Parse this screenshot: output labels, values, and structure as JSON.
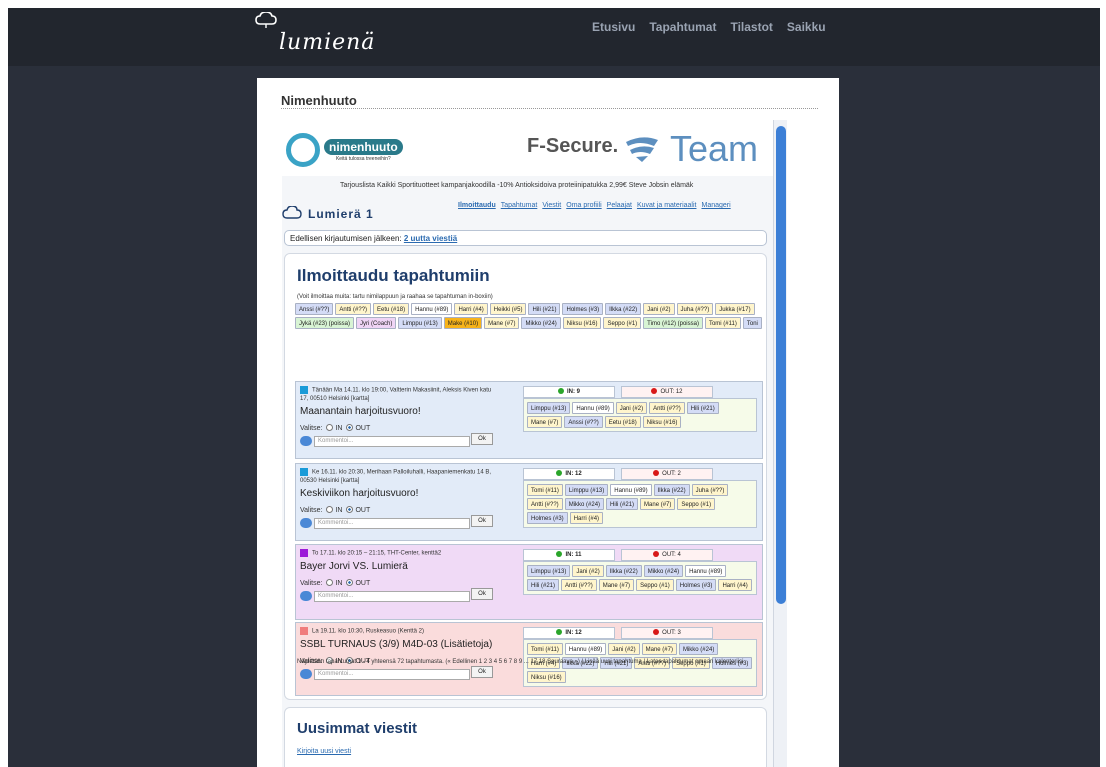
{
  "site": {
    "logo": "lumienä"
  },
  "topnav": [
    "Etusivu",
    "Tapahtumat",
    "Tilastot",
    "Saikku"
  ],
  "content": {
    "title": "Nimenhuuto"
  },
  "banner": {
    "nh_name": "nimenhuuto",
    "nh_tag": "Keitä tulossa treeneihin?",
    "fsecure": "F-Secure.",
    "team": "Team",
    "ticker": "Tarjouslista   Kaikki Sportituotteet kampanjakoodilla -10%    Antioksidoiva proteiinipatukka 2,99€    Steve Jobsin elämäk"
  },
  "subnav": [
    "Ilmoittaudu",
    "Tapahtumat",
    "Viestit",
    "Oma profiili",
    "Pelaajat",
    "Kuvat ja materiaalit",
    "Manageri"
  ],
  "team_name": "Lumierä 1",
  "since": {
    "label": "Edellisen kirjautumisen jälkeen:",
    "link": "2 uutta viestiä"
  },
  "signup": {
    "heading": "Ilmoittaudu tapahtumiin",
    "hint": "(Voit ilmoittaa muita: tartu nimilappuun ja raahaa se tapahtuman in-boxiin)",
    "players": [
      {
        "n": "Anssi (#??)",
        "c": "b"
      },
      {
        "n": "Antti (#??)",
        "c": "y"
      },
      {
        "n": "Eetu (#18)",
        "c": "y"
      },
      {
        "n": "Hannu (#89)",
        "c": "w"
      },
      {
        "n": "Harri (#4)",
        "c": "y"
      },
      {
        "n": "Heikki (#5)",
        "c": "y"
      },
      {
        "n": "Hili (#21)",
        "c": "b"
      },
      {
        "n": "Holmes (#3)",
        "c": "b"
      },
      {
        "n": "Ilkka (#22)",
        "c": "b"
      },
      {
        "n": "Jani (#2)",
        "c": "y"
      },
      {
        "n": "Juha (#??)",
        "c": "y"
      },
      {
        "n": "Jukka (#17)",
        "c": "y"
      },
      {
        "n": "Jykä (#23) (poissa)",
        "c": "g"
      },
      {
        "n": "Jyri (Coach)",
        "c": "p"
      },
      {
        "n": "Limppu (#13)",
        "c": "b"
      },
      {
        "n": "Make (#10)",
        "c": "o"
      },
      {
        "n": "Mane (#7)",
        "c": "y"
      },
      {
        "n": "Mikko (#24)",
        "c": "b"
      },
      {
        "n": "Niksu (#16)",
        "c": "y"
      },
      {
        "n": "Seppo (#1)",
        "c": "y"
      },
      {
        "n": "Timo (#12) (poissa)",
        "c": "g"
      },
      {
        "n": "Tomi (#11)",
        "c": "y"
      },
      {
        "n": "Toni",
        "c": "b"
      }
    ],
    "events": [
      {
        "info": "Tänään Ma 14.11. klo 19:00, Valtterin Makasiinit, Aleksis Kiven katu 17, 00510 Helsinki [kartta]",
        "title": "Maanantain harjoitusvuoro!",
        "valitse": "Valitse:",
        "in": "IN",
        "out": "OUT",
        "placeholder": "Kommentoi...",
        "ok": "Ok",
        "in_count": "IN: 9",
        "out_count": "OUT: 12",
        "color": "#1a9bd8",
        "bg": "#e2ebf8",
        "inbox": [
          "Limppu (#13)",
          "Hannu (#89)",
          "Jani (#2)",
          "Antti (#??)",
          "Hili (#21)",
          "Mane (#7)",
          "Anssi (#??)",
          "Eetu (#18)",
          "Niksu (#16)"
        ]
      },
      {
        "info": "Ke 16.11. klo 20:30, Merihaan Palloiluhalli, Haapaniemenkatu 14 B, 00530 Helsinki [kartta]",
        "title": "Keskiviikon harjoitusvuoro!",
        "valitse": "Valitse:",
        "in": "IN",
        "out": "OUT",
        "placeholder": "Kommentoi...",
        "ok": "Ok",
        "in_count": "IN: 12",
        "out_count": "OUT: 2",
        "color": "#1a9bd8",
        "bg": "#e2ebf8",
        "inbox": [
          "Tomi (#11)",
          "Limppu (#13)",
          "Hannu (#89)",
          "Ilkka (#22)",
          "Juha (#??)",
          "Antti (#??)",
          "Mikko (#24)",
          "Hili (#21)",
          "Mane (#7)",
          "Seppo (#1)",
          "Holmes (#3)",
          "Harri (#4)"
        ]
      },
      {
        "info": "To 17.11. klo 20:15 – 21:15, THT-Center, kenttä2",
        "title": "Bayer Jorvi VS. Lumierä",
        "valitse": "Valitse:",
        "in": "IN",
        "out": "OUT",
        "placeholder": "Kommentoi...",
        "ok": "Ok",
        "in_count": "IN: 11",
        "out_count": "OUT: 4",
        "color": "#9c1ad8",
        "bg": "#f0daf6",
        "inbox": [
          "Limppu (#13)",
          "Jani (#2)",
          "Ilkka (#22)",
          "Mikko (#24)",
          "Hannu (#89)",
          "Hili (#21)",
          "Antti (#??)",
          "Mane (#7)",
          "Seppo (#1)",
          "Holmes (#3)",
          "Harri (#4)"
        ]
      },
      {
        "info": "La 19.11. klo 10:30, Ruskeasuo (Kenttä 2)",
        "title": "SSBL TURNAUS (3/9) M4D-03 (Lisätietoja)",
        "valitse": "Valitse:",
        "in": "IN",
        "out": "OUT",
        "placeholder": "Kommentoi...",
        "ok": "Ok",
        "in_count": "IN: 12",
        "out_count": "OUT: 3",
        "color": "#f07c7c",
        "bg": "#fadcdc",
        "inbox": [
          "Tomi (#11)",
          "Hannu (#89)",
          "Jani (#2)",
          "Mane (#7)",
          "Mikko (#24)",
          "Harri (#4)",
          "Ilkka (#22)",
          "Hili (#21)",
          "Antti (#??)",
          "Seppo (#1)",
          "Holmes (#3)",
          "Niksu (#16)"
        ]
      }
    ],
    "pager": "Näytetään tapahtumat 1 - 4 yhteensä 72 tapahtumasta. (« Edellinen 1 2 3 4 5 6 7 8 9 ... 17 18 Seuraava ») | Lisää uusi tapahtuma | Lataa tapahtumat omaan kalenteriisi"
  },
  "messages": {
    "heading": "Uusimmat viestit",
    "link": "Kirjoita uusi viesti"
  }
}
